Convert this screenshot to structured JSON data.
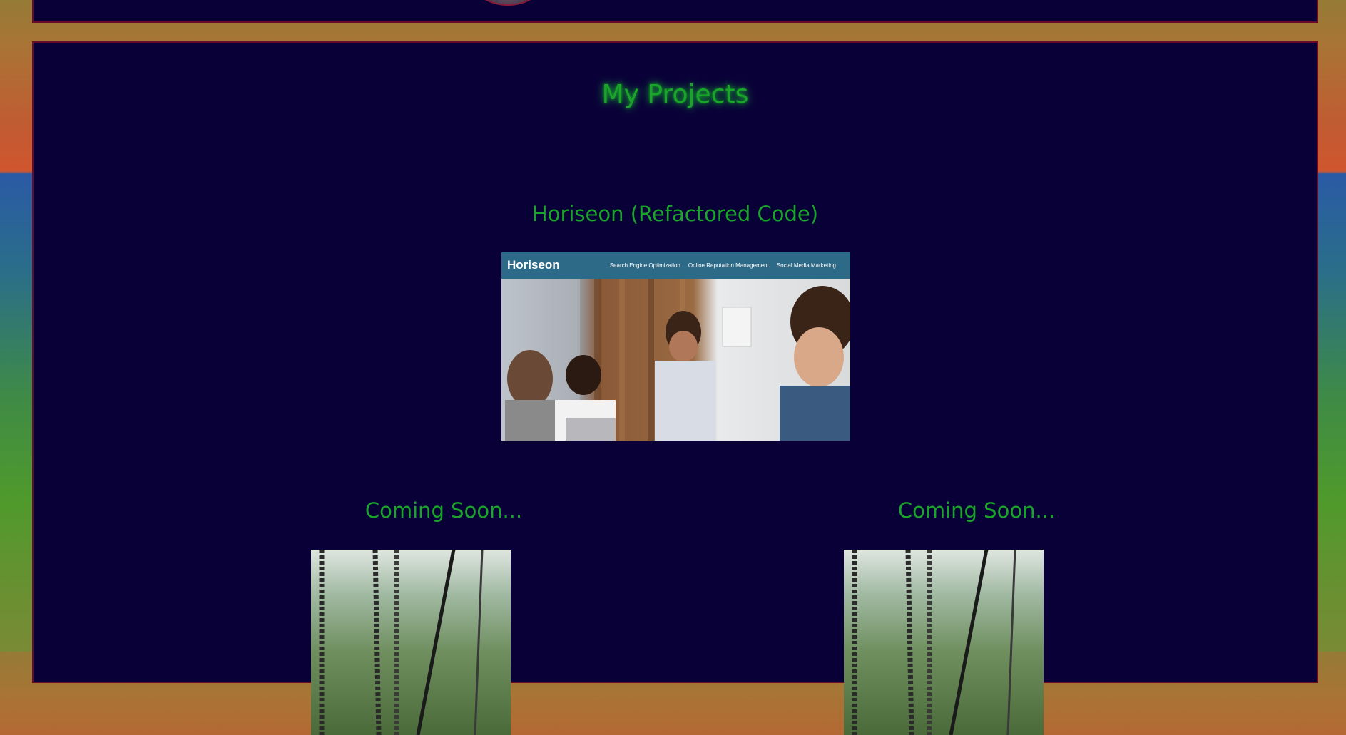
{
  "page": {
    "title": "My Projects"
  },
  "projects": {
    "featured": {
      "title": "Horiseon (Refactored Code)",
      "screenshot": {
        "logo": "Horiseon",
        "nav_links": [
          "Search Engine Optimization",
          "Online Reputation Management",
          "Social Media Marketing"
        ]
      }
    },
    "upcoming": [
      {
        "title": "Coming Soon..."
      },
      {
        "title": "Coming Soon..."
      }
    ]
  },
  "colors": {
    "panel_background": "#0a0038",
    "panel_border": "#6a0a2a",
    "heading_green": "#1aa52a",
    "horiseon_nav": "#2d6a88"
  }
}
